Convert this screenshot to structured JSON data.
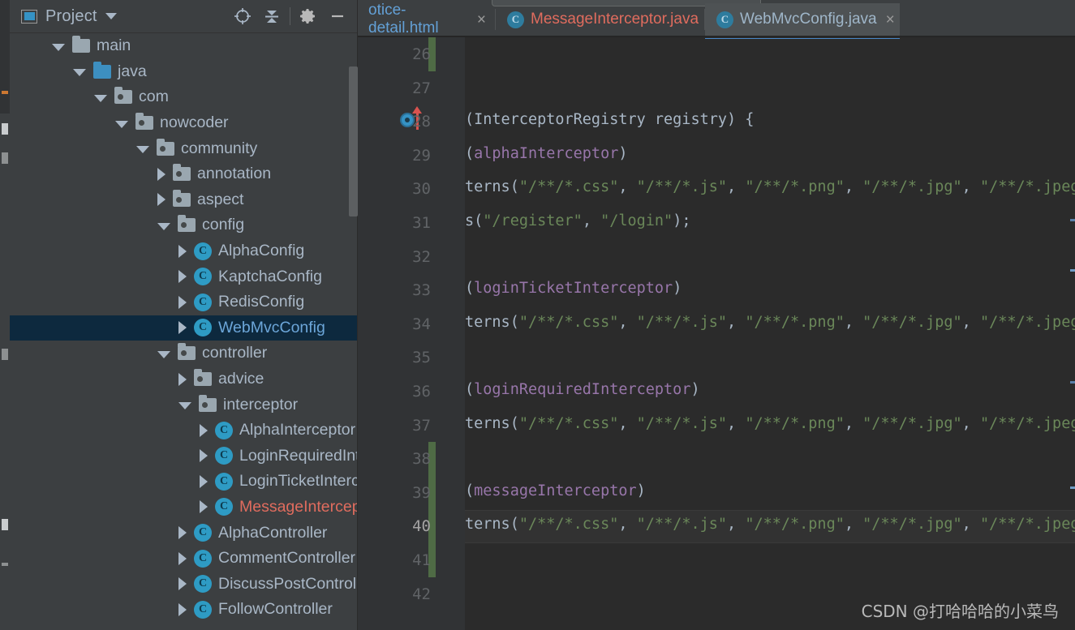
{
  "window": {
    "theme": "darcula",
    "accent_color": "#4a88c7",
    "panel_bg": "#3c3f41",
    "editor_bg": "#2b2b2b",
    "gutter_bg": "#313335",
    "selection_bg": "#0d293e"
  },
  "project_panel": {
    "title": "Project",
    "icons": {
      "panel": "project-window-icon",
      "dropdown": "chevron-down-icon",
      "locate": "locate-file-icon",
      "collapse": "collapse-all-icon",
      "settings": "gear-icon",
      "hide": "minimize-icon"
    },
    "tree": [
      {
        "label": "main",
        "depth": 1,
        "arrow": "open",
        "icon": "folder",
        "state": "normal"
      },
      {
        "label": "java",
        "depth": 2,
        "arrow": "open",
        "icon": "folder-src",
        "state": "normal"
      },
      {
        "label": "com",
        "depth": 3,
        "arrow": "open",
        "icon": "folder-pkg",
        "state": "normal"
      },
      {
        "label": "nowcoder",
        "depth": 4,
        "arrow": "open",
        "icon": "folder-pkg",
        "state": "normal"
      },
      {
        "label": "community",
        "depth": 5,
        "arrow": "open",
        "icon": "folder-pkg",
        "state": "normal"
      },
      {
        "label": "annotation",
        "depth": 6,
        "arrow": "closed",
        "icon": "folder-pkg",
        "state": "normal"
      },
      {
        "label": "aspect",
        "depth": 6,
        "arrow": "closed",
        "icon": "folder-pkg",
        "state": "normal"
      },
      {
        "label": "config",
        "depth": 6,
        "arrow": "open",
        "icon": "folder-pkg",
        "state": "normal"
      },
      {
        "label": "AlphaConfig",
        "depth": 7,
        "arrow": "closed",
        "icon": "java-class",
        "state": "normal"
      },
      {
        "label": "KaptchaConfig",
        "depth": 7,
        "arrow": "closed",
        "icon": "java-class",
        "state": "normal"
      },
      {
        "label": "RedisConfig",
        "depth": 7,
        "arrow": "closed",
        "icon": "java-class",
        "state": "normal"
      },
      {
        "label": "WebMvcConfig",
        "depth": 7,
        "arrow": "closed",
        "icon": "java-class",
        "state": "selected"
      },
      {
        "label": "controller",
        "depth": 6,
        "arrow": "open",
        "icon": "folder-pkg",
        "state": "normal"
      },
      {
        "label": "advice",
        "depth": 7,
        "arrow": "closed",
        "icon": "folder-pkg",
        "state": "normal"
      },
      {
        "label": "interceptor",
        "depth": 7,
        "arrow": "open",
        "icon": "folder-pkg",
        "state": "normal"
      },
      {
        "label": "AlphaInterceptor",
        "depth": 8,
        "arrow": "closed",
        "icon": "java-class",
        "state": "normal"
      },
      {
        "label": "LoginRequiredInte",
        "depth": 8,
        "arrow": "closed",
        "icon": "java-class",
        "state": "normal"
      },
      {
        "label": "LoginTicketIntercep",
        "depth": 8,
        "arrow": "closed",
        "icon": "java-class",
        "state": "normal"
      },
      {
        "label": "MessageIntercepto",
        "depth": 8,
        "arrow": "closed",
        "icon": "java-class",
        "state": "modified"
      },
      {
        "label": "AlphaController",
        "depth": 7,
        "arrow": "closed",
        "icon": "java-class",
        "state": "normal"
      },
      {
        "label": "CommentController",
        "depth": 7,
        "arrow": "closed",
        "icon": "java-class",
        "state": "normal"
      },
      {
        "label": "DiscussPostController",
        "depth": 7,
        "arrow": "closed",
        "icon": "java-class",
        "state": "normal"
      },
      {
        "label": "FollowController",
        "depth": 7,
        "arrow": "closed",
        "icon": "java-class",
        "state": "normal"
      }
    ]
  },
  "editor": {
    "tabs": [
      {
        "label": "otice-detail.html",
        "icon": "html-file-icon",
        "state": "normal",
        "close": "×"
      },
      {
        "label": "MessageInterceptor.java",
        "icon": "java-class-icon",
        "state": "modified",
        "close": "×"
      },
      {
        "label": "WebMvcConfig.java",
        "icon": "java-class-icon",
        "state": "active",
        "close": "×"
      }
    ],
    "first_line_number": 26,
    "current_line": 40,
    "gutter_markers": {
      "override_line": 28,
      "override_icon": "override-method-icon"
    },
    "lines": [
      {
        "n": 26,
        "tokens": []
      },
      {
        "n": 27,
        "tokens": []
      },
      {
        "n": 28,
        "tokens": [
          {
            "t": "(InterceptorRegistry registry) {",
            "c": "id"
          }
        ]
      },
      {
        "n": 29,
        "tokens": [
          {
            "t": "(",
            "c": "pn"
          },
          {
            "t": "alphaInterceptor",
            "c": "fld"
          },
          {
            "t": ")",
            "c": "pn"
          }
        ]
      },
      {
        "n": 30,
        "tokens": [
          {
            "t": "terns",
            "c": "id"
          },
          {
            "t": "(",
            "c": "pn"
          },
          {
            "t": "\"/**/*.css\"",
            "c": "str"
          },
          {
            "t": ", ",
            "c": "pn"
          },
          {
            "t": "\"/**/*.js\"",
            "c": "str"
          },
          {
            "t": ", ",
            "c": "pn"
          },
          {
            "t": "\"/**/*.png\"",
            "c": "str"
          },
          {
            "t": ", ",
            "c": "pn"
          },
          {
            "t": "\"/**/*.jpg\"",
            "c": "str"
          },
          {
            "t": ", ",
            "c": "pn"
          },
          {
            "t": "\"/**/*.jpeg\"",
            "c": "str"
          },
          {
            "t": ")",
            "c": "pn"
          }
        ]
      },
      {
        "n": 31,
        "tokens": [
          {
            "t": "s",
            "c": "id"
          },
          {
            "t": "(",
            "c": "pn"
          },
          {
            "t": "\"/register\"",
            "c": "str"
          },
          {
            "t": ", ",
            "c": "pn"
          },
          {
            "t": "\"/login\"",
            "c": "str"
          },
          {
            "t": ");",
            "c": "pn"
          }
        ]
      },
      {
        "n": 32,
        "tokens": []
      },
      {
        "n": 33,
        "tokens": [
          {
            "t": "(",
            "c": "pn"
          },
          {
            "t": "loginTicketInterceptor",
            "c": "fld"
          },
          {
            "t": ")",
            "c": "pn"
          }
        ]
      },
      {
        "n": 34,
        "tokens": [
          {
            "t": "terns",
            "c": "id"
          },
          {
            "t": "(",
            "c": "pn"
          },
          {
            "t": "\"/**/*.css\"",
            "c": "str"
          },
          {
            "t": ", ",
            "c": "pn"
          },
          {
            "t": "\"/**/*.js\"",
            "c": "str"
          },
          {
            "t": ", ",
            "c": "pn"
          },
          {
            "t": "\"/**/*.png\"",
            "c": "str"
          },
          {
            "t": ", ",
            "c": "pn"
          },
          {
            "t": "\"/**/*.jpg\"",
            "c": "str"
          },
          {
            "t": ", ",
            "c": "pn"
          },
          {
            "t": "\"/**/*.jpeg\"",
            "c": "str"
          },
          {
            "t": ");",
            "c": "pn"
          }
        ]
      },
      {
        "n": 35,
        "tokens": []
      },
      {
        "n": 36,
        "tokens": [
          {
            "t": "(",
            "c": "pn"
          },
          {
            "t": "loginRequiredInterceptor",
            "c": "fld"
          },
          {
            "t": ")",
            "c": "pn"
          }
        ]
      },
      {
        "n": 37,
        "tokens": [
          {
            "t": "terns",
            "c": "id"
          },
          {
            "t": "(",
            "c": "pn"
          },
          {
            "t": "\"/**/*.css\"",
            "c": "str"
          },
          {
            "t": ", ",
            "c": "pn"
          },
          {
            "t": "\"/**/*.js\"",
            "c": "str"
          },
          {
            "t": ", ",
            "c": "pn"
          },
          {
            "t": "\"/**/*.png\"",
            "c": "str"
          },
          {
            "t": ", ",
            "c": "pn"
          },
          {
            "t": "\"/**/*.jpg\"",
            "c": "str"
          },
          {
            "t": ", ",
            "c": "pn"
          },
          {
            "t": "\"/**/*.jpeg\"",
            "c": "str"
          },
          {
            "t": ");",
            "c": "pn"
          }
        ]
      },
      {
        "n": 38,
        "tokens": []
      },
      {
        "n": 39,
        "tokens": [
          {
            "t": "(",
            "c": "pn"
          },
          {
            "t": "messageInterceptor",
            "c": "fld"
          },
          {
            "t": ")",
            "c": "pn"
          }
        ]
      },
      {
        "n": 40,
        "tokens": [
          {
            "t": "terns",
            "c": "id"
          },
          {
            "t": "(",
            "c": "pn"
          },
          {
            "t": "\"/**/*.css\"",
            "c": "str"
          },
          {
            "t": ", ",
            "c": "pn"
          },
          {
            "t": "\"/**/*.js\"",
            "c": "str"
          },
          {
            "t": ", ",
            "c": "pn"
          },
          {
            "t": "\"/**/*.png\"",
            "c": "str"
          },
          {
            "t": ", ",
            "c": "pn"
          },
          {
            "t": "\"/**/*.jpg\"",
            "c": "str"
          },
          {
            "t": ", ",
            "c": "pn"
          },
          {
            "t": "\"/**/*.jpeg\"",
            "c": "str"
          },
          {
            "t": ");",
            "c": "pn"
          }
        ]
      },
      {
        "n": 41,
        "tokens": []
      },
      {
        "n": 42,
        "tokens": []
      }
    ]
  },
  "watermark": "CSDN @打哈哈哈的小菜鸟"
}
